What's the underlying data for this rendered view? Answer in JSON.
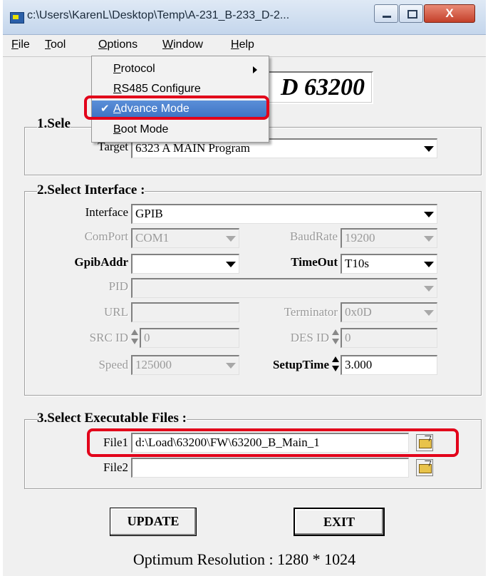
{
  "window": {
    "title": "c:\\Users\\KarenL\\Desktop\\Temp\\A-231_B-233_D-2...",
    "close_label": "X"
  },
  "menubar": {
    "items": [
      "File",
      "Tool",
      "Options",
      "Window",
      "Help"
    ]
  },
  "options_menu": {
    "items": [
      {
        "label": "Protocol",
        "submenu": true
      },
      {
        "label": "RS485 Configure"
      },
      {
        "label": "Advance Mode",
        "checked": true,
        "highlighted": true
      },
      {
        "label": "Boot Mode"
      }
    ],
    "check_glyph": "✔"
  },
  "model": {
    "text": "D 63200"
  },
  "section1": {
    "title": "1.Sele",
    "target_label": "Target",
    "target_value": "6323 A MAIN Program"
  },
  "section2": {
    "title": "2.Select Interface :",
    "interface_label": "Interface",
    "interface_value": "GPIB",
    "comport_label": "ComPort",
    "comport_value": "COM1",
    "baudrate_label": "BaudRate",
    "baudrate_value": "19200",
    "gpibaddr_label": "GpibAddr",
    "gpibaddr_value": "",
    "timeout_label": "TimeOut",
    "timeout_value": "T10s",
    "pid_label": "PID",
    "pid_value": "",
    "url_label": "URL",
    "url_value": "",
    "terminator_label": "Terminator",
    "terminator_value": "0x0D",
    "srcid_label": "SRC ID",
    "srcid_value": "0",
    "desid_label": "DES ID",
    "desid_value": "0",
    "speed_label": "Speed",
    "speed_value": "125000",
    "setuptime_label": "SetupTime",
    "setuptime_value": "3.000"
  },
  "section3": {
    "title": "3.Select Executable Files :",
    "file1_label": "File1",
    "file1_value": "d:\\Load\\63200\\FW\\63200_B_Main_1",
    "file2_label": "File2",
    "file2_value": ""
  },
  "buttons": {
    "update": "UPDATE",
    "exit": "EXIT"
  },
  "footer": {
    "text": "Optimum Resolution : 1280 * 1024"
  },
  "colors": {
    "highlight_box": "#e2001a",
    "menu_highlight": "#3d73c4"
  }
}
